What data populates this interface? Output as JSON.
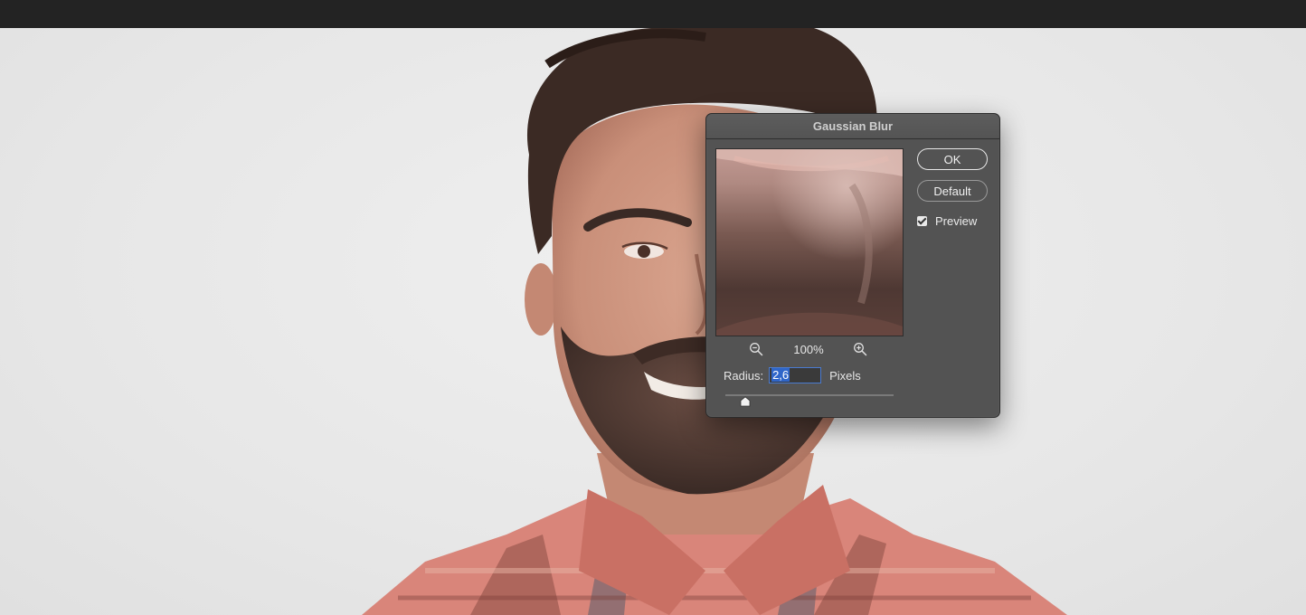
{
  "dialog": {
    "title": "Gaussian Blur",
    "ok_label": "OK",
    "default_label": "Default",
    "preview_label": "Preview",
    "preview_checked": true,
    "zoom_level": "100%",
    "zoom_out_icon": "zoom-out-icon",
    "zoom_in_icon": "zoom-in-icon",
    "radius_label": "Radius:",
    "radius_value": "2,6",
    "radius_unit": "Pixels",
    "slider_fraction": 0.12
  },
  "colors": {
    "dialog_bg": "#535353",
    "topbar_bg": "#232323",
    "selection": "#2f66c9"
  }
}
